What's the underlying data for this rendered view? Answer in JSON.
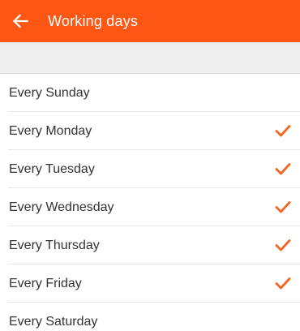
{
  "header": {
    "title": "Working days",
    "back_icon": "arrow-left-icon",
    "background_color": "#fe5614"
  },
  "accent_color": "#f26522",
  "days": [
    {
      "label": "Every Sunday",
      "checked": false
    },
    {
      "label": "Every Monday",
      "checked": true
    },
    {
      "label": "Every Tuesday",
      "checked": true
    },
    {
      "label": "Every Wednesday",
      "checked": true
    },
    {
      "label": "Every Thursday",
      "checked": true
    },
    {
      "label": "Every Friday",
      "checked": true
    },
    {
      "label": "Every Saturday",
      "checked": false
    }
  ]
}
